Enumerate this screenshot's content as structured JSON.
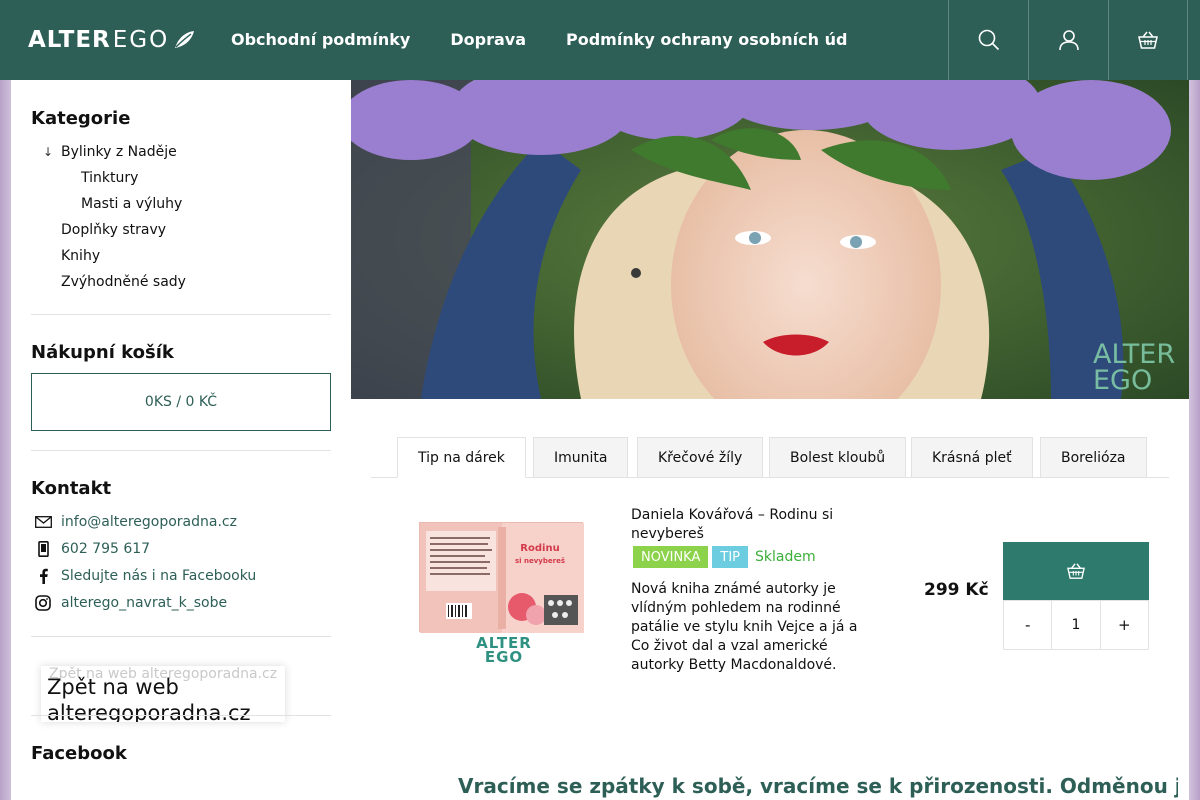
{
  "header": {
    "logo_alter": "ALTER",
    "logo_ego": "EGO",
    "nav": [
      {
        "label": "Obchodní podmínky"
      },
      {
        "label": "Doprava"
      },
      {
        "label": "Podmínky ochrany osobních údajů"
      }
    ],
    "icons": [
      "search-icon",
      "user-icon",
      "basket-icon"
    ],
    "color_bg": "#2e5f57"
  },
  "sidebar": {
    "categories_title": "Kategorie",
    "categories": [
      {
        "label": "Bylinky z Naděje",
        "expanded": true,
        "arrow": "↓"
      },
      {
        "label": "Tinktury"
      },
      {
        "label": "Masti a výluhy"
      },
      {
        "label": "Doplňky stravy"
      },
      {
        "label": "Knihy"
      },
      {
        "label": "Zvýhodněné sady"
      }
    ],
    "cart_title": "Nákupní košík",
    "cart_summary": "0KS / 0 KČ",
    "contact_title": "Kontakt",
    "contacts": [
      {
        "icon": "mail-icon",
        "text": "info@alteregoporadna.cz"
      },
      {
        "icon": "phone-icon",
        "text": "602 795 617"
      },
      {
        "icon": "facebook-icon",
        "text": "Sledujte nás i na Facebooku"
      },
      {
        "icon": "instagram-icon",
        "text": "alterego_navrat_k_sobe"
      }
    ],
    "back_ghost": "Zpět na web alteregoporadna.cz",
    "back_link": "Zpět na web alteregoporadna.cz",
    "facebook_title": "Facebook"
  },
  "hero": {
    "watermark_alter": "ALTER",
    "watermark_ego": "EGO"
  },
  "tabs": [
    {
      "label": "Tip na dárek",
      "active": true
    },
    {
      "label": "Imunita"
    },
    {
      "label": "Křečové žíly"
    },
    {
      "label": "Bolest kloubů"
    },
    {
      "label": "Krásná pleť"
    },
    {
      "label": "Borelióza"
    }
  ],
  "product": {
    "image_logo_alter": "ALTER",
    "image_logo_ego": "EGO",
    "title": "Daniela Kovářová – Rodinu si nevybereš",
    "badge_new": "NOVINKA",
    "badge_tip": "TIP",
    "stock": "Skladem",
    "description": "Nová kniha známé autorky je vlídným pohledem na rodinné patálie ve stylu knih Vejce a já a Co život dal a vzal americké autorky Betty Macdonaldové.",
    "price": "299 Kč",
    "qty_minus": "-",
    "qty_value": "1",
    "qty_plus": "+",
    "colors": {
      "new": "#8cd24a",
      "tip": "#6ccde0",
      "stock": "#3cae3a",
      "buy": "#2e7a6c"
    }
  },
  "tagline": "Vracíme se zpátky k sobě, vracíme se k přirozenosti. Odměnou je nám"
}
